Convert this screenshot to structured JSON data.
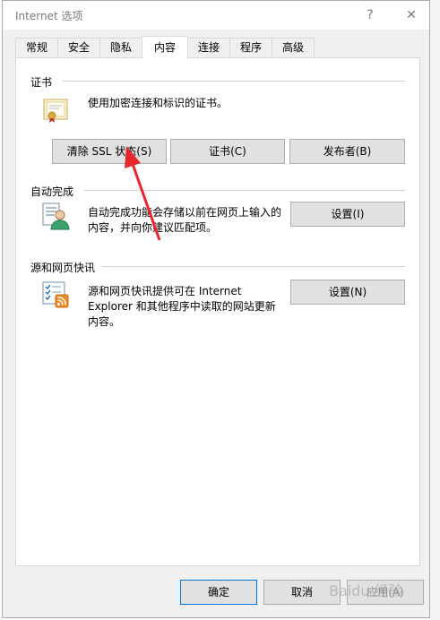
{
  "window": {
    "title": "Internet 选项",
    "help_symbol": "?",
    "close_symbol": "✕"
  },
  "tabs": [
    {
      "label": "常规"
    },
    {
      "label": "安全"
    },
    {
      "label": "隐私"
    },
    {
      "label": "内容",
      "active": true
    },
    {
      "label": "连接"
    },
    {
      "label": "程序"
    },
    {
      "label": "高级"
    }
  ],
  "certificates": {
    "heading": "证书",
    "description": "使用加密连接和标识的证书。",
    "icon": "certificate-icon",
    "buttons": {
      "clear_ssl": "清除 SSL 状态(S)",
      "certificates": "证书(C)",
      "publishers": "发布者(B)"
    }
  },
  "autocomplete": {
    "heading": "自动完成",
    "description_line1": "自动完成功能会存储以前在网页上输入的",
    "description_line2": "内容，并向你建议匹配项。",
    "icon": "autocomplete-user-icon",
    "settings_button": "设置(I)"
  },
  "feeds": {
    "heading": "源和网页快讯",
    "description_line1": "源和网页快讯提供可在 Internet",
    "description_line2": "Explorer 和其他程序中读取的网站更新",
    "description_line3": "内容。",
    "icon": "feeds-rss-icon",
    "settings_button": "设置(N)"
  },
  "footer": {
    "ok": "确定",
    "cancel": "取消",
    "apply": "应用(A)"
  },
  "watermark": "Baidu 经验",
  "colors": {
    "annotation_arrow": "#e8262d",
    "default_button_border": "#0078d7"
  }
}
